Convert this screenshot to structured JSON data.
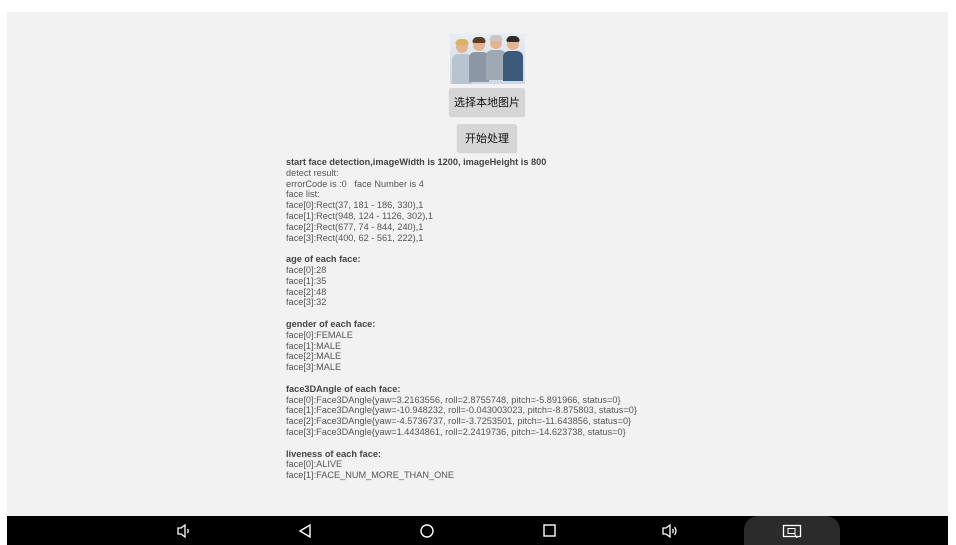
{
  "buttons": {
    "select_image": "选择本地图片",
    "start_process": "开始处理"
  },
  "log_lines": [
    {
      "text": "start face detection,imageWidth is 1200, imageHeight is 800",
      "bold": true
    },
    {
      "text": "detect result:",
      "bold": false
    },
    {
      "text": "errorCode is :0   face Number is 4",
      "bold": false
    },
    {
      "text": "face list:",
      "bold": false
    },
    {
      "text": "face[0]:Rect(37, 181 - 186, 330),1",
      "bold": false
    },
    {
      "text": "face[1]:Rect(948, 124 - 1126, 302),1",
      "bold": false
    },
    {
      "text": "face[2]:Rect(677, 74 - 844, 240),1",
      "bold": false
    },
    {
      "text": "face[3]:Rect(400, 62 - 561, 222),1",
      "bold": false
    },
    {
      "text": "",
      "bold": false
    },
    {
      "text": "age of each face:",
      "bold": true
    },
    {
      "text": "face[0]:28",
      "bold": false
    },
    {
      "text": "face[1]:35",
      "bold": false
    },
    {
      "text": "face[2]:48",
      "bold": false
    },
    {
      "text": "face[3]:32",
      "bold": false
    },
    {
      "text": "",
      "bold": false
    },
    {
      "text": "gender of each face:",
      "bold": true
    },
    {
      "text": "face[0]:FEMALE",
      "bold": false
    },
    {
      "text": "face[1]:MALE",
      "bold": false
    },
    {
      "text": "face[2]:MALE",
      "bold": false
    },
    {
      "text": "face[3]:MALE",
      "bold": false
    },
    {
      "text": "",
      "bold": false
    },
    {
      "text": "face3DAngle of each face:",
      "bold": true
    },
    {
      "text": "face[0]:Face3DAngle{yaw=3.2163556, roll=2.8755748, pitch=-5.891966, status=0}",
      "bold": false
    },
    {
      "text": "face[1]:Face3DAngle{yaw=-10.948232, roll=-0.043003023, pitch=-8.875803, status=0}",
      "bold": false
    },
    {
      "text": "face[2]:Face3DAngle{yaw=-4.5736737, roll=-3.7253501, pitch=-11.643856, status=0}",
      "bold": false
    },
    {
      "text": "face[3]:Face3DAngle{yaw=1.4434861, roll=2.2419736, pitch=-14.623738, status=0}",
      "bold": false
    },
    {
      "text": "",
      "bold": false
    },
    {
      "text": "liveness of each face:",
      "bold": true
    },
    {
      "text": "face[0]:ALIVE",
      "bold": false
    },
    {
      "text": "face[1]:FACE_NUM_MORE_THAN_ONE",
      "bold": false
    }
  ],
  "navbar": {
    "icons": [
      "volume-down-icon",
      "back-icon",
      "home-icon",
      "recents-icon",
      "volume-up-icon",
      "screenshot-icon"
    ]
  },
  "colors": {
    "background": "#f2f2f2",
    "button": "#d6d6d6",
    "navbar": "#000000",
    "text": "#555555"
  }
}
